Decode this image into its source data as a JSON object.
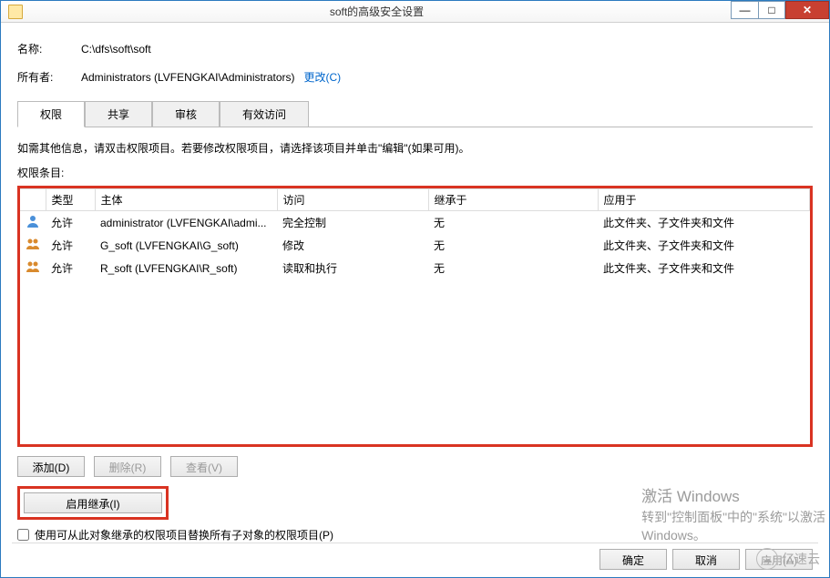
{
  "titlebar": {
    "title": "soft的高级安全设置"
  },
  "info": {
    "name_label": "名称:",
    "name_value": "C:\\dfs\\soft\\soft",
    "owner_label": "所有者:",
    "owner_value": "Administrators (LVFENGKAI\\Administrators)",
    "change_link": "更改(C)"
  },
  "tabs": {
    "permissions": "权限",
    "share": "共享",
    "audit": "审核",
    "effective": "有效访问"
  },
  "instruction": "如需其他信息，请双击权限项目。若要修改权限项目，请选择该项目并单击\"编辑\"(如果可用)。",
  "list_label": "权限条目:",
  "columns": {
    "type": "类型",
    "principal": "主体",
    "access": "访问",
    "inherited": "继承于",
    "applies": "应用于"
  },
  "rows": [
    {
      "icon": "single",
      "type": "允许",
      "principal": "administrator (LVFENGKAI\\admi...",
      "access": "完全控制",
      "inherited": "无",
      "applies": "此文件夹、子文件夹和文件"
    },
    {
      "icon": "group",
      "type": "允许",
      "principal": "G_soft (LVFENGKAI\\G_soft)",
      "access": "修改",
      "inherited": "无",
      "applies": "此文件夹、子文件夹和文件"
    },
    {
      "icon": "group",
      "type": "允许",
      "principal": "R_soft (LVFENGKAI\\R_soft)",
      "access": "读取和执行",
      "inherited": "无",
      "applies": "此文件夹、子文件夹和文件"
    }
  ],
  "buttons": {
    "add": "添加(D)",
    "remove": "删除(R)",
    "view": "查看(V)",
    "enable_inherit": "启用继承(I)",
    "ok": "确定",
    "cancel": "取消",
    "apply": "应用(A)"
  },
  "checkbox_label": "使用可从此对象继承的权限项目替换所有子对象的权限项目(P)",
  "watermark": {
    "line1": "激活 Windows",
    "line2": "转到\"控制面板\"中的\"系统\"以激活",
    "line3": "Windows。"
  },
  "brand": "亿速云"
}
